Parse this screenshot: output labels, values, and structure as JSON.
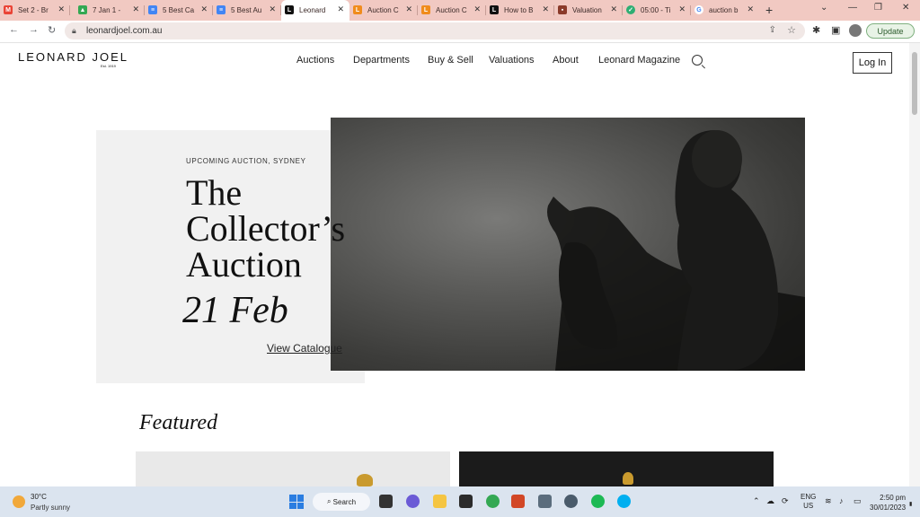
{
  "browser": {
    "tabs": [
      {
        "label": "Set 2 - Br",
        "icon": "gmail-icon",
        "color": "#ea4335"
      },
      {
        "label": "7 Jan 1 -",
        "icon": "drive-icon",
        "color": "#34a853"
      },
      {
        "label": "5 Best Ca",
        "icon": "docs-icon",
        "color": "#4285f4"
      },
      {
        "label": "5 Best Au",
        "icon": "docs-icon",
        "color": "#4285f4"
      },
      {
        "label": "Leonard",
        "icon": "leonard-icon",
        "color": "#111111"
      },
      {
        "label": "Auction C",
        "icon": "site-icon",
        "color": "#f08c1c"
      },
      {
        "label": "Auction C",
        "icon": "site-icon",
        "color": "#f08c1c"
      },
      {
        "label": "How to B",
        "icon": "leonard-icon",
        "color": "#111111"
      },
      {
        "label": "Valuation",
        "icon": "site-icon",
        "color": "#8a3a2a"
      },
      {
        "label": "05:00 - Ti",
        "icon": "timer-icon",
        "color": "#2fae73"
      },
      {
        "label": "auction b",
        "icon": "google-icon",
        "color": "#4285f4"
      }
    ],
    "url": "leonardjoel.com.au",
    "update_label": "Update"
  },
  "site": {
    "logo": "LEONARD JOEL",
    "logo_sub": "Est. 1919",
    "nav": [
      "Auctions",
      "Departments",
      "Buy & Sell",
      "Valuations",
      "About",
      "Leonard Magazine"
    ],
    "login": "Log In"
  },
  "hero": {
    "kicker": "UPCOMING AUCTION, SYDNEY",
    "title_line1": "The",
    "title_line2": "Collector’s",
    "title_line3": "Auction",
    "date": "21 Feb",
    "cta": "View Catalogue"
  },
  "featured": {
    "heading": "Featured"
  },
  "taskbar": {
    "temperature": "30°C",
    "condition": "Partly sunny",
    "search_label": "Search",
    "lang_line1": "ENG",
    "lang_line2": "US",
    "time": "2:50 pm",
    "date": "30/01/2023"
  }
}
